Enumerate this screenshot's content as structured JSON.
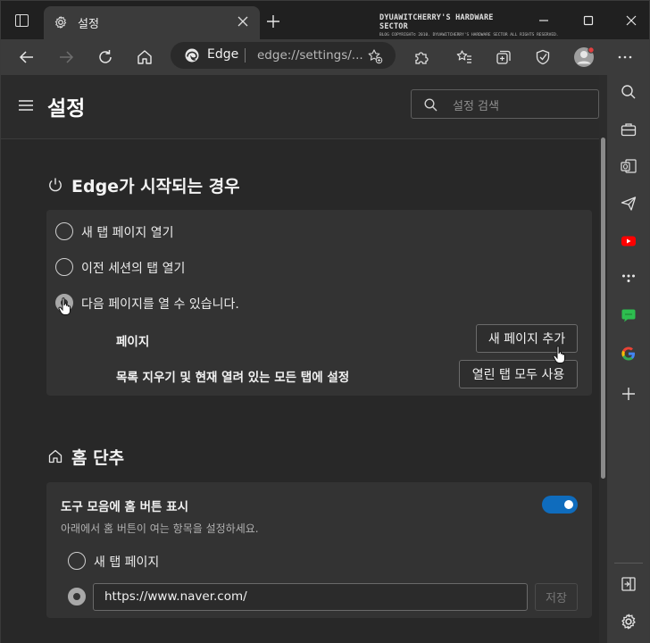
{
  "window": {
    "tab_title": "설정",
    "watermark_line1": "DYUAWITCHERRY'S HARDWARE SECTOR",
    "watermark_line2": "BLOG COPYRIGHT© 2010. DYUAWITCHERRY'S HARDWARE SECTOR ALL RIGHTS RESERVED."
  },
  "addressbar": {
    "label": "Edge",
    "url": "edge://settings/..."
  },
  "header": {
    "title": "설정",
    "search_placeholder": "설정 검색"
  },
  "startup": {
    "title": "Edge가 시작되는 경우",
    "options": [
      {
        "label": "새 탭 페이지 열기",
        "checked": false
      },
      {
        "label": "이전 세션의 탭 열기",
        "checked": false
      },
      {
        "label": "다음 페이지를 열 수 있습니다.",
        "checked": true
      }
    ],
    "pages_label": "페이지",
    "add_page_button": "새 페이지 추가",
    "clear_label": "목록 지우기 및 현재 열려 있는 모든 탭에 설정",
    "use_open_tabs_button": "열린 탭 모두 사용"
  },
  "home": {
    "title": "홈 단추",
    "show_home_label": "도구 모음에 홈 버튼 표시",
    "show_home_enabled": true,
    "description": "아래에서 홈 버튼이 여는 항목을 설정하세요.",
    "option_newtab": "새 탭 페이지",
    "url_value": "https://www.naver.com/",
    "save_button": "저장"
  },
  "colors": {
    "accent": "#0f6cbd",
    "youtube": "#ff0000",
    "google_blue": "#4285f4"
  }
}
